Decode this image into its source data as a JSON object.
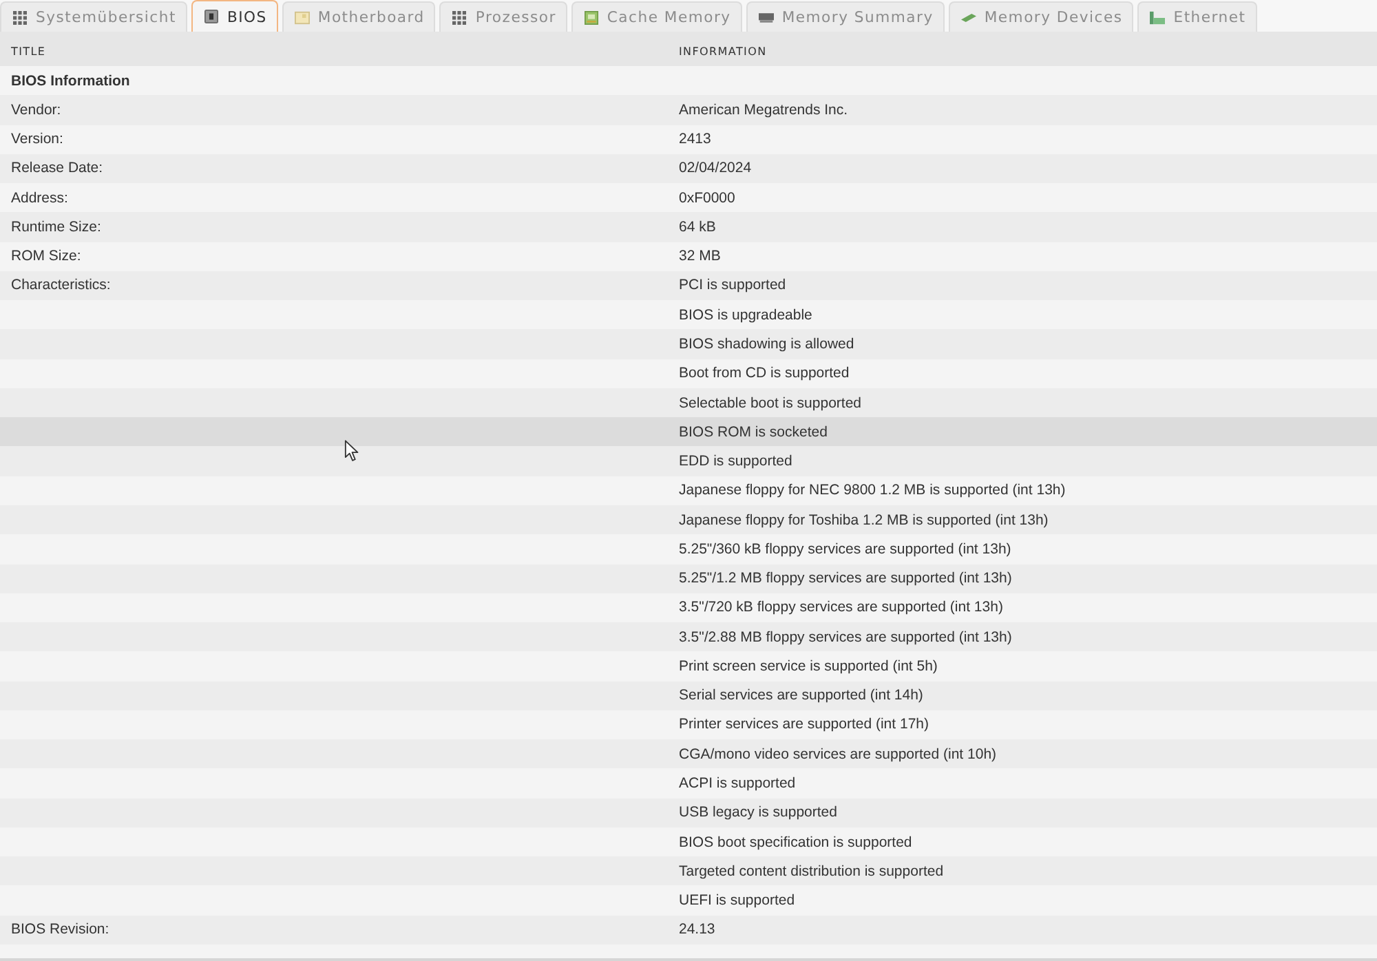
{
  "tabs": [
    {
      "label": "Systemübersicht",
      "selected": false
    },
    {
      "label": "BIOS",
      "selected": true
    },
    {
      "label": "Motherboard",
      "selected": false
    },
    {
      "label": "Prozessor",
      "selected": false
    },
    {
      "label": "Cache Memory",
      "selected": false
    },
    {
      "label": "Memory Summary",
      "selected": false
    },
    {
      "label": "Memory Devices",
      "selected": false
    },
    {
      "label": "Ethernet",
      "selected": false
    }
  ],
  "table": {
    "columns": [
      "TITLE",
      "INFORMATION"
    ],
    "rows": [
      {
        "kind": "section",
        "title": "BIOS Information",
        "hovered": false
      },
      {
        "kind": "field",
        "title": "Vendor:",
        "value": "American Megatrends Inc.",
        "hovered": false
      },
      {
        "kind": "field",
        "title": "Version:",
        "value": "2413",
        "hovered": false
      },
      {
        "kind": "field",
        "title": "Release Date:",
        "value": "02/04/2024",
        "hovered": false
      },
      {
        "kind": "field",
        "title": "Address:",
        "value": "0xF0000",
        "hovered": false
      },
      {
        "kind": "field",
        "title": "Runtime Size:",
        "value": "64 kB",
        "hovered": false
      },
      {
        "kind": "field",
        "title": "ROM Size:",
        "value": "32 MB",
        "hovered": false
      },
      {
        "kind": "field",
        "title": "Characteristics:",
        "value": "PCI is supported",
        "hovered": false
      },
      {
        "kind": "field",
        "value": "BIOS is upgradeable",
        "hovered": false
      },
      {
        "kind": "field",
        "value": "BIOS shadowing is allowed",
        "hovered": false
      },
      {
        "kind": "field",
        "value": "Boot from CD is supported",
        "hovered": false
      },
      {
        "kind": "field",
        "value": "Selectable boot is supported",
        "hovered": false
      },
      {
        "kind": "field",
        "value": "BIOS ROM is socketed",
        "hovered": true
      },
      {
        "kind": "field",
        "value": "EDD is supported",
        "hovered": false
      },
      {
        "kind": "field",
        "value": "Japanese floppy for NEC 9800 1.2 MB is supported (int 13h)",
        "hovered": false
      },
      {
        "kind": "field",
        "value": "Japanese floppy for Toshiba 1.2 MB is supported (int 13h)",
        "hovered": false
      },
      {
        "kind": "field",
        "value": "5.25\"/360 kB floppy services are supported (int 13h)",
        "hovered": false
      },
      {
        "kind": "field",
        "value": "5.25\"/1.2 MB floppy services are supported (int 13h)",
        "hovered": false
      },
      {
        "kind": "field",
        "value": "3.5\"/720 kB floppy services are supported (int 13h)",
        "hovered": false
      },
      {
        "kind": "field",
        "value": "3.5\"/2.88 MB floppy services are supported (int 13h)",
        "hovered": false
      },
      {
        "kind": "field",
        "value": "Print screen service is supported (int 5h)",
        "hovered": false
      },
      {
        "kind": "field",
        "value": "Serial services are supported (int 14h)",
        "hovered": false
      },
      {
        "kind": "field",
        "value": "Printer services are supported (int 17h)",
        "hovered": false
      },
      {
        "kind": "field",
        "value": "CGA/mono video services are supported (int 10h)",
        "hovered": false
      },
      {
        "kind": "field",
        "value": "ACPI is supported",
        "hovered": false
      },
      {
        "kind": "field",
        "value": "USB legacy is supported",
        "hovered": false
      },
      {
        "kind": "field",
        "value": "BIOS boot specification is supported",
        "hovered": false
      },
      {
        "kind": "field",
        "value": "Targeted content distribution is supported",
        "hovered": false
      },
      {
        "kind": "field",
        "value": "UEFI is supported",
        "hovered": false
      },
      {
        "kind": "field",
        "title": "BIOS Revision:",
        "value": "24.13",
        "hovered": false
      }
    ]
  }
}
